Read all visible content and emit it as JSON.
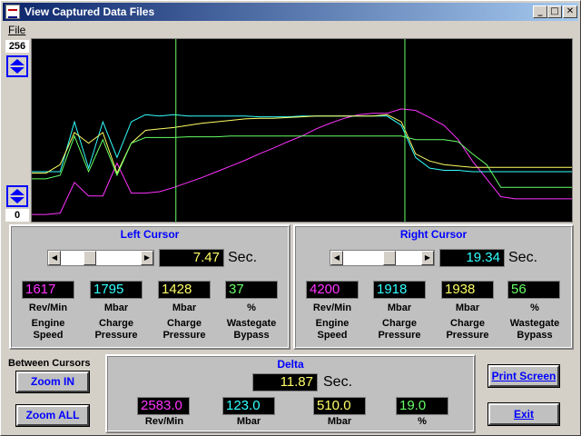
{
  "window": {
    "title": "View Captured Data Files",
    "controls": [
      "minimize-icon",
      "maximize-icon",
      "close-icon"
    ]
  },
  "menu": {
    "file": "File"
  },
  "scale": {
    "top": "256",
    "bottom": "0"
  },
  "colors": {
    "rev": "#ff33ff",
    "mbar1": "#33ffff",
    "mbar2": "#ffff66",
    "pct": "#66ff66"
  },
  "chart_data": {
    "type": "line",
    "ylim": [
      0,
      256
    ],
    "cursors": {
      "left": 7.47,
      "right": 19.34
    },
    "series": [
      {
        "color": "#ff33ff",
        "values": [
          10,
          10,
          12,
          55,
          36,
          36,
          82,
          40,
          40,
          42,
          48,
          55,
          62,
          70,
          78,
          86,
          95,
          103,
          112,
          120,
          130,
          138,
          145,
          150,
          152,
          152,
          158,
          156,
          146,
          135,
          115,
          85,
          60,
          35,
          32,
          32,
          32,
          32,
          32
        ]
      },
      {
        "color": "#33ffff",
        "values": [
          70,
          70,
          70,
          140,
          75,
          140,
          90,
          140,
          150,
          148,
          150,
          148,
          148,
          148,
          148,
          148,
          147,
          147,
          147,
          148,
          148,
          148,
          148,
          148,
          148,
          148,
          135,
          90,
          75,
          72,
          72,
          70,
          70,
          70,
          70,
          70,
          70,
          70,
          70
        ]
      },
      {
        "color": "#ffff66",
        "values": [
          68,
          68,
          80,
          125,
          110,
          125,
          68,
          110,
          128,
          130,
          132,
          135,
          138,
          140,
          142,
          144,
          145,
          145,
          146,
          147,
          148,
          148,
          148,
          148,
          148,
          150,
          140,
          95,
          85,
          80,
          78,
          76,
          76,
          76,
          76,
          76,
          76,
          76,
          76
        ]
      },
      {
        "color": "#66ff66",
        "values": [
          60,
          60,
          65,
          120,
          70,
          115,
          65,
          110,
          118,
          118,
          118,
          119,
          119,
          119,
          120,
          120,
          120,
          120,
          120,
          120,
          120,
          120,
          120,
          120,
          120,
          120,
          120,
          115,
          115,
          115,
          112,
          95,
          80,
          48,
          48,
          48,
          48,
          48,
          48
        ]
      }
    ]
  },
  "left": {
    "title": "Left Cursor",
    "time": "7.47",
    "sec": "Sec.",
    "values": [
      "1617",
      "1795",
      "1428",
      "37"
    ],
    "units": [
      "Rev/Min",
      "Mbar",
      "Mbar",
      "%"
    ],
    "captions": [
      "Engine\nSpeed",
      "Charge\nPressure",
      "Charge\nPressure",
      "Wastegate\nBypass"
    ],
    "slider_position": 0.33
  },
  "right": {
    "title": "Right Cursor",
    "time": "19.34",
    "sec": "Sec.",
    "values": [
      "4200",
      "1918",
      "1938",
      "56"
    ],
    "units": [
      "Rev/Min",
      "Mbar",
      "Mbar",
      "%"
    ],
    "captions": [
      "Engine\nSpeed",
      "Charge\nPressure",
      "Charge\nPressure",
      "Wastegate\nBypass"
    ],
    "slider_position": 0.6
  },
  "between": {
    "label": "Between Cursors",
    "zoom_in": "Zoom IN",
    "zoom_all": "Zoom ALL"
  },
  "delta": {
    "title": "Delta",
    "time": "11.87",
    "sec": "Sec.",
    "values": [
      "2583.0",
      "123.0",
      "510.0",
      "19.0"
    ],
    "units": [
      "Rev/Min",
      "Mbar",
      "Mbar",
      "%"
    ]
  },
  "actions": {
    "print": "Print Screen",
    "exit": "Exit"
  }
}
